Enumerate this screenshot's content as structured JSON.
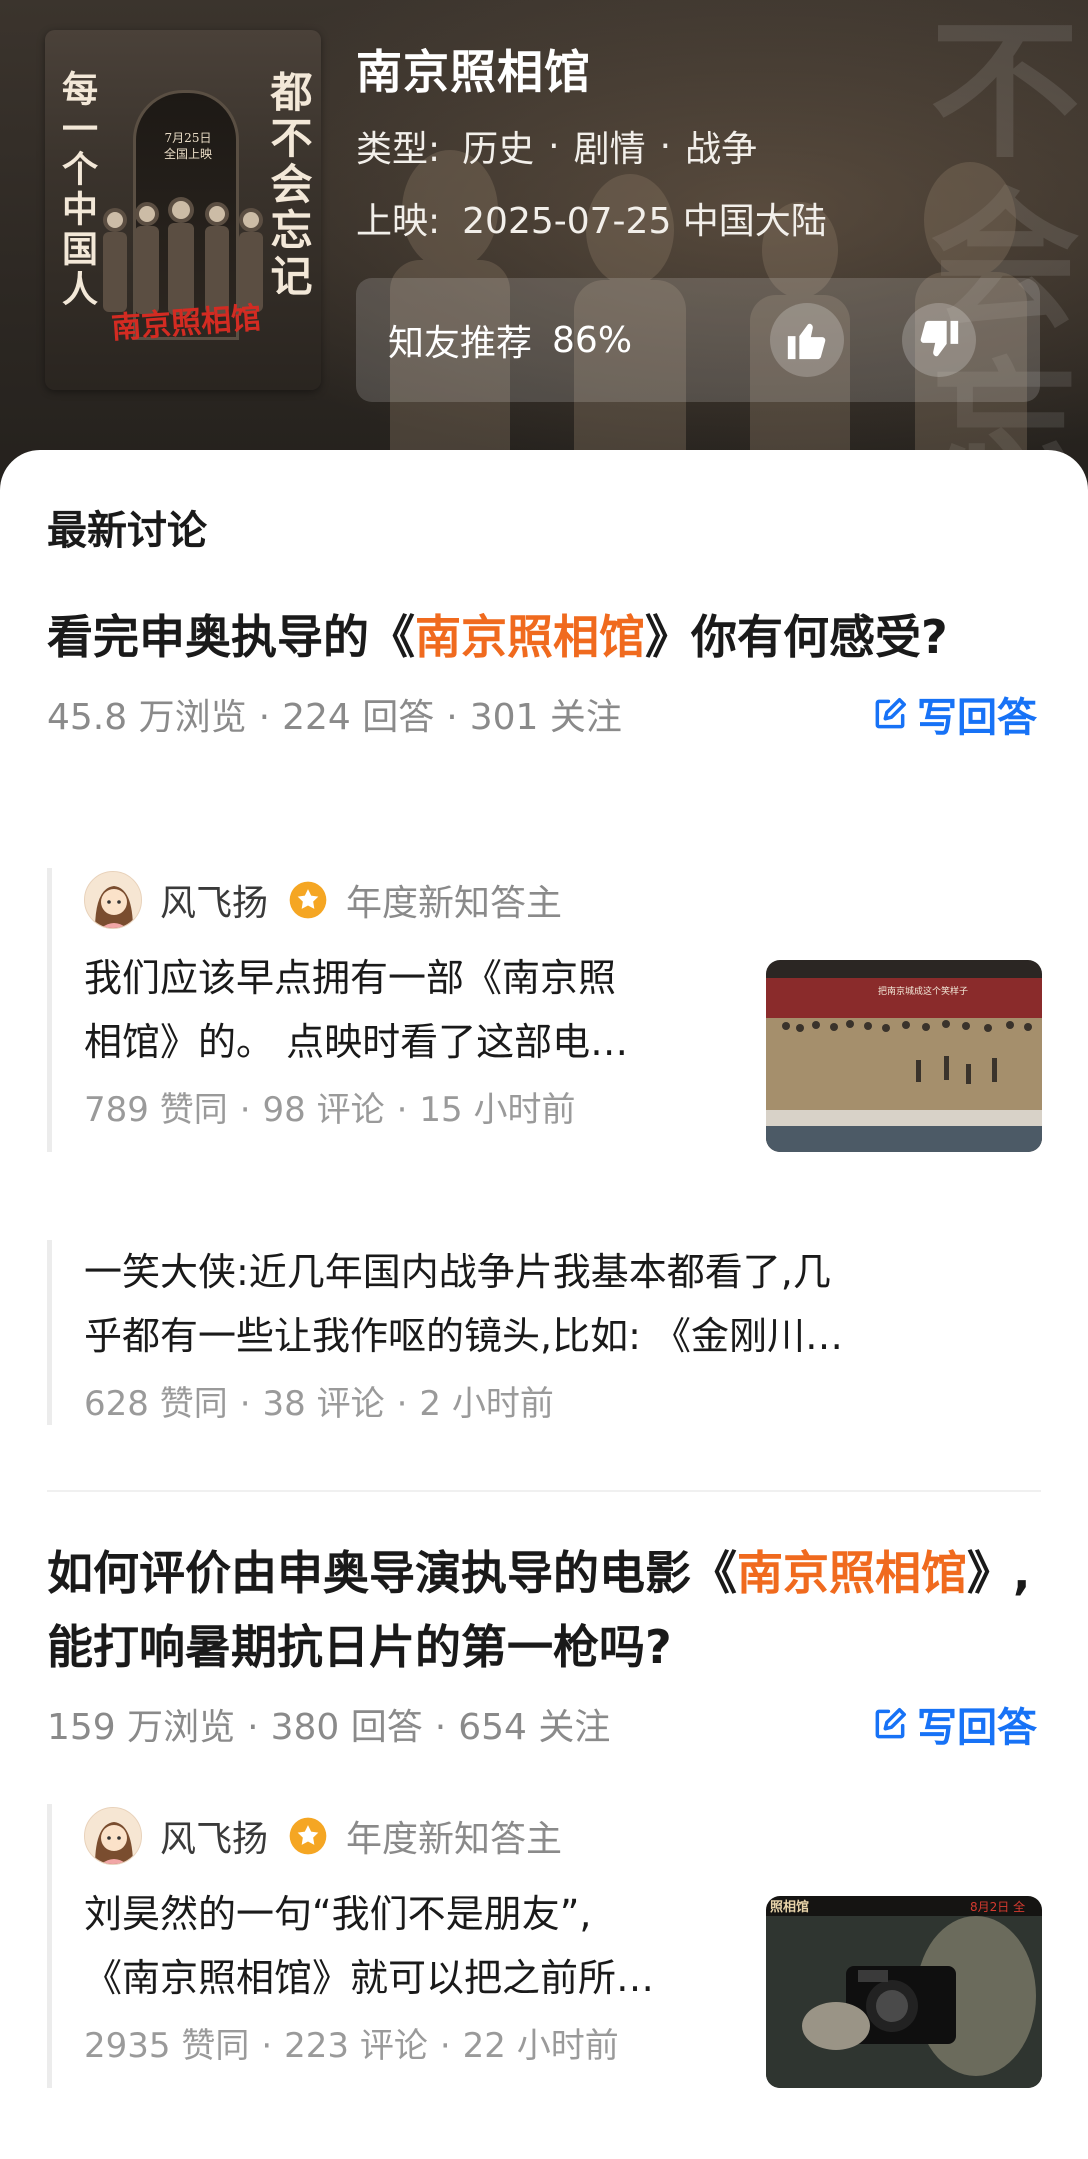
{
  "movie": {
    "title": "南京照相馆",
    "genre_label": "类型:",
    "genres": [
      "历史",
      "剧情",
      "战争"
    ],
    "genre_separator": "·",
    "release_label": "上映:",
    "release_value": "2025-07-25 中国大陆",
    "recommend_label": "知友推荐",
    "recommend_pct": "86%",
    "poster": {
      "left_text": "每一个中国人",
      "right_text": "都不会忘记",
      "date_line1": "7月25日",
      "date_line2": "全国上映",
      "logo": "南京照相馆"
    },
    "bg_chars": [
      "不",
      "会",
      "忘"
    ]
  },
  "section_title": "最新讨论",
  "questions": [
    {
      "title_pre": "看完申奥执导的《",
      "title_highlight": "南京照相馆",
      "title_post": "》你有何感受?",
      "views": "45.8 万浏览",
      "answers": "224 回答",
      "follows": "301 关注",
      "write_label": "写回答",
      "answers_list": [
        {
          "author": "风飞扬",
          "badge": "年度新知答主",
          "text_line1": "我们应该早点拥有一部《南京照",
          "text_line2": "相馆》的。 点映时看了这部电…",
          "likes": "789 赞同",
          "comments": "98 评论",
          "time": "15 小时前",
          "thumb_caption": "把南京城成这个笑样子"
        },
        {
          "text_line1": "一笑大侠:近几年国内战争片我基本都看了,几",
          "text_line2": "乎都有一些让我作呕的镜头,比如: 《金刚川…",
          "likes": "628 赞同",
          "comments": "38 评论",
          "time": "2 小时前"
        }
      ]
    },
    {
      "title_pre": "如何评价由申奥导演执导的电影《",
      "title_highlight": "南京照相馆",
      "title_post": "》,能打响暑期抗日片的第一枪吗?",
      "views": "159 万浏览",
      "answers": "380 回答",
      "follows": "654 关注",
      "write_label": "写回答",
      "answers_list": [
        {
          "author": "风飞扬",
          "badge": "年度新知答主",
          "text_line1": "刘昊然的一句“我们不是朋友”,",
          "text_line2": "《南京照相馆》就可以把之前所…",
          "likes": "2935 赞同",
          "comments": "223 评论",
          "time": "22 小时前",
          "thumb_caption_left": "照相馆",
          "thumb_caption_right": "8月2日 全"
        }
      ]
    }
  ],
  "separator": "·",
  "colors": {
    "accent_orange": "#f06a1e",
    "link_blue": "#1772f6",
    "badge_orange": "#f5a623"
  }
}
